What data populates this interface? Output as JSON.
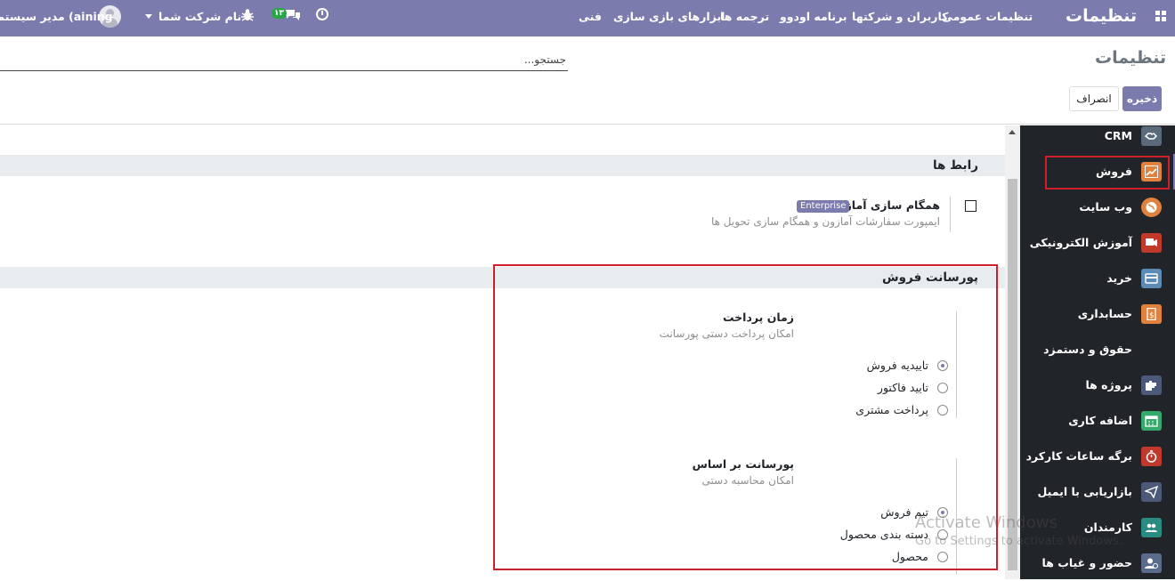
{
  "colors": {
    "brand": "#7c7bad",
    "sidebar_bg": "#212529",
    "annotation_red": "#d11f2a"
  },
  "navbar": {
    "brand": "تنظیمات",
    "menu": [
      "تنظیمات عمومی",
      "کاربران و شرکتها",
      "برنامه اودوو",
      "ترجمه ها",
      "ابزارهای بازی سازی",
      "فنی"
    ],
    "company": "نام شرکت شما",
    "user": "مدیر سیستم (aining",
    "chat_count": "۱۳",
    "icons": [
      "apps-icon",
      "bug-icon",
      "chat-icon",
      "clock-icon",
      "avatar"
    ]
  },
  "control_panel": {
    "title": "تنظیمات",
    "search_placeholder": "جستجو...",
    "save_label": "ذخیره",
    "discard_label": "انصراف"
  },
  "sidebar": {
    "selected": "فروش",
    "items": [
      {
        "label": "CRM",
        "icon": "crm-icon",
        "color": "#5a6a7a"
      },
      {
        "label": "فروش",
        "icon": "sales-icon",
        "color": "#e0823d"
      },
      {
        "label": "وب سایت",
        "icon": "website-icon",
        "color": "#e0823d"
      },
      {
        "label": "آموزش الکترونیکی",
        "icon": "elearning-icon",
        "color": "#c0392b"
      },
      {
        "label": "خرید",
        "icon": "purchase-icon",
        "color": "#5b8bb5"
      },
      {
        "label": "حسابداری",
        "icon": "accounting-icon",
        "color": "#e0823d"
      },
      {
        "label": "حقوق و دستمزد",
        "icon": "",
        "color": ""
      },
      {
        "label": "پروژه ها",
        "icon": "project-icon",
        "color": "#4a5a78"
      },
      {
        "label": "اضافه کاری",
        "icon": "overtime-icon",
        "color": "#35a86b"
      },
      {
        "label": "برگه ساعات کارکرد",
        "icon": "timesheet-icon",
        "color": "#c0392b"
      },
      {
        "label": "بازاریابی با ایمیل",
        "icon": "email-marketing-icon",
        "color": "#4a5a78"
      },
      {
        "label": "کارمندان",
        "icon": "employees-icon",
        "color": "#2a8b82"
      },
      {
        "label": "حضور و غیاب ها",
        "icon": "attendance-icon",
        "color": "#5b6b8b"
      }
    ]
  },
  "content": {
    "connectors": {
      "title": "رابط ها",
      "amazon": {
        "title": "همگام سازی آمازون",
        "badge": "Enterprise",
        "description": "ایمپورت سفارشات آمازون و همگام سازی تحویل ها",
        "checked": false
      }
    },
    "commission": {
      "title": "پورسانت فروش",
      "payment_time": {
        "title": "زمان پرداخت",
        "description": "امکان پرداخت دستی پورسانت",
        "options": [
          "تاییدیه فروش",
          "تایید فاکتور",
          "پرداخت مشتری"
        ],
        "selected": 0
      },
      "based_on": {
        "title": "پورسانت بر اساس",
        "description": "امکان محاسبه دستی",
        "options": [
          "تیم فروش",
          "دسته بندی محصول",
          "محصول"
        ],
        "selected": 0
      }
    }
  },
  "watermark": {
    "title": "Activate Windows",
    "subtitle": "Go to Settings to activate Windows."
  }
}
